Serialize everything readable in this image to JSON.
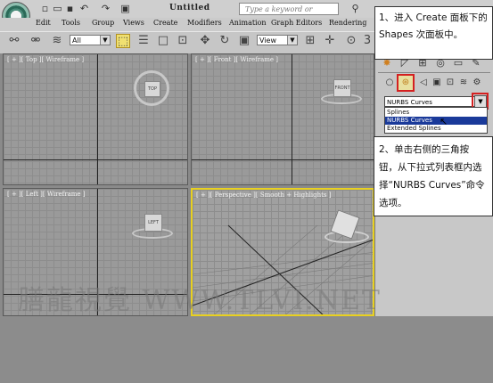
{
  "window": {
    "title": "Untitled",
    "search_placeholder": "Type a keyword or phrase"
  },
  "menu": [
    "Edit",
    "Tools",
    "Group",
    "Views",
    "Create",
    "Modifiers",
    "Animation",
    "Graph Editors",
    "Rendering"
  ],
  "toolbar": {
    "selection_filter": "All",
    "reference_coord": "View"
  },
  "viewports": [
    {
      "label": "[ + ][ Top ][ Wireframe ]",
      "cube_label": "TOP"
    },
    {
      "label": "[ + ][ Front ][ Wireframe ]",
      "cube_label": "FRONT"
    },
    {
      "label": "[ + ][ Left ][ Wireframe ]",
      "cube_label": "LEFT"
    },
    {
      "label": "[ + ][ Perspective ][ Smooth + Highlights ]",
      "cube_label": ""
    }
  ],
  "command_panel": {
    "dropdown_value": "NURBS Curves",
    "options": [
      "Splines",
      "NURBS Curves",
      "Extended Splines"
    ],
    "selected_index": 1
  },
  "callouts": {
    "step1": "1、进入 Create 面板下的 Shapes 次面板中。",
    "step2": "2、单击右侧的三角按钮，从下拉式列表框内选择“NURBS Curves”命令选项。"
  },
  "watermark": "膳龍視覺 WWW.TLVI.NET",
  "colors": {
    "highlight_red": "#d42020",
    "active_viewport": "#e8d020",
    "selection_blue": "#1a3a9a"
  }
}
